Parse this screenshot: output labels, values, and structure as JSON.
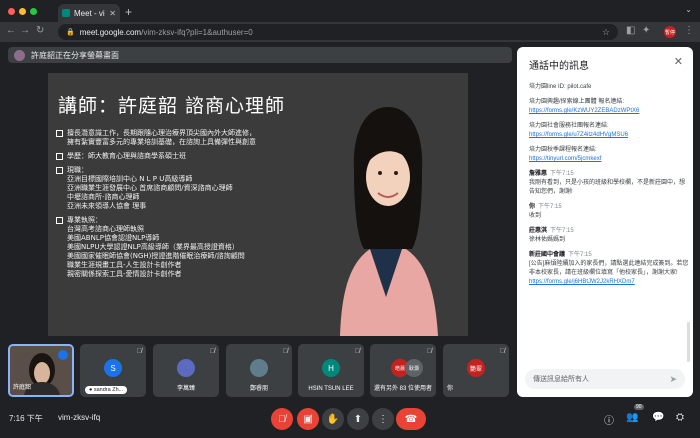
{
  "browser": {
    "tab_title": "Meet - vim-zksv-ifq",
    "url_host": "meet.google.com",
    "url_path": "/vim-zksv-ifq?pli=1&authuser=0",
    "profile_label": "暫停"
  },
  "presenting": {
    "text": "許庭韶正在分享螢幕畫面"
  },
  "slide": {
    "heading": "講師：許庭韶 諮商心理師",
    "bullets": [
      {
        "text": "擅長潛意識工作，長期跟隨心理治療界頂尖國內外大師進修，",
        "sub": "擁有紮實豐富多元的專業培訓基礎，在諮詢上具備彈性與創意"
      },
      {
        "text": "學歷：師大教育心理與諮商學系碩士班",
        "sub": ""
      },
      {
        "text": "現職：",
        "sub": "亞洲目標國際培訓中心 N L P U高級導師\n亞洲職業生涯發展中心 首席諮商顧問/資深諮商心理師\n中壢諮商所-諮商心理師\n亞洲未來領導人協會 理事"
      },
      {
        "text": "專業執照：",
        "sub": "台灣高考諮商心理師執照\n美國ABNLP協會認證NLP導師\n美國NLPU大學認證NLP高級導師（業界最高授證資格）\n美國國家催眠師協會(NGH)授證進階催眠治療師/諮詢顧問\n職業生涯規畫工具-人生設計卡創作者\n親密關係探索工具-愛情設計卡創作者"
      }
    ]
  },
  "chat": {
    "header": "通話中的訊息",
    "messages": [
      {
        "sender": "",
        "time": "",
        "text": "培力園line ID: pilot.cafe"
      },
      {
        "sender": "",
        "time": "",
        "text": "培力園興趣/探索線上團體 報名連結:",
        "link": "https://forms.gle/KzWUY2ZEBADzWPtX6"
      },
      {
        "sender": "",
        "time": "",
        "text": "培力園社會服務社團報名連結:",
        "link": "https://forms.gle/u7Z4itz4dHVgMSU6"
      },
      {
        "sender": "",
        "time": "",
        "text": "培力園秋季課程報名連結:",
        "link": "https://tinyurl.com/5jcmkexf"
      },
      {
        "sender": "詹雅惠",
        "time": "下午7:15",
        "text": "我剛有看到，只是小孩的班級和學校欄，不是新莊園中，想告知您們，謝謝!"
      },
      {
        "sender": "你",
        "time": "下午7:15",
        "text": "收到"
      },
      {
        "sender": "莊惠淇",
        "time": "下午7:15",
        "text": "徐林佑媽媽到"
      },
      {
        "sender": "新莊國中會議",
        "time": "下午7:15",
        "text": "[公告]麻煩陸續加入的家長們，請點選此連結完成簽到。若您非本校家長，請在班級欄位填寫「他校家長」，謝謝大家!",
        "link": "https://forms.gle/j6HBtJW2J2kRHXDm7"
      }
    ],
    "input_placeholder": "傳送訊息給所有人"
  },
  "tiles": [
    {
      "name": "許庭韶"
    },
    {
      "name": "sandra Zh...",
      "initial": "S",
      "color": "#1a73e8"
    },
    {
      "name": "李萬臻",
      "initial": "",
      "color": "#5c6bc0"
    },
    {
      "name": "鄭睿朋",
      "initial": "",
      "color": "#607d8b"
    },
    {
      "name": "HSIN TSUN LEE",
      "initial": "H",
      "color": "#00897b"
    },
    {
      "name": "還有另外 83 位使用者",
      "initial": "",
      "color": "#3c4043",
      "a": "皓晨",
      "b": "耿灝"
    },
    {
      "name": "你",
      "initial": "艷翠",
      "color": "#c5221f"
    }
  ],
  "bottom": {
    "time": "7:16 下午",
    "meeting_code": "vim-zksv-ifq",
    "participant_count": "90"
  }
}
